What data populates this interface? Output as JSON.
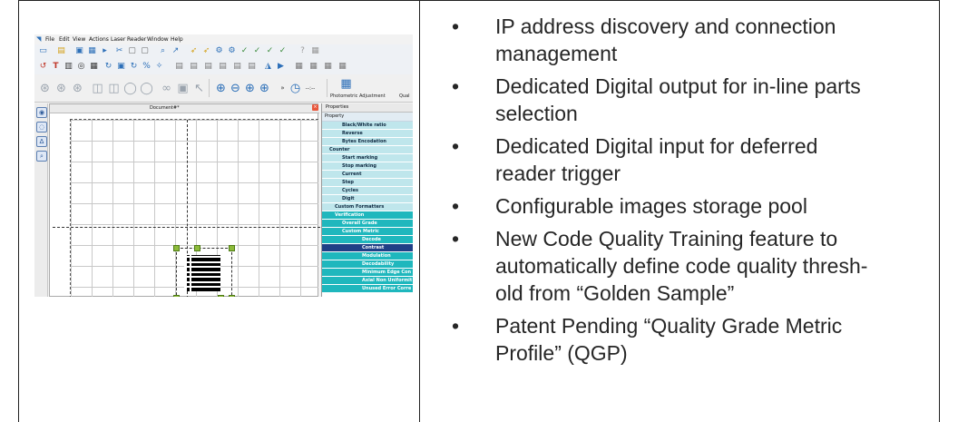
{
  "screenshot": {
    "menu": [
      "File",
      "Edit",
      "View",
      "Actions",
      "Laser",
      "Reader",
      "Window",
      "Help"
    ],
    "toolbar_labels": [
      "Photometric Adjustment",
      "Qual"
    ],
    "document_tab": "Document#*",
    "properties_panel": {
      "title": "Properties",
      "header": "Property",
      "rows": [
        {
          "label": "Black/White ratio",
          "style": "light"
        },
        {
          "label": "Reverse",
          "style": "light"
        },
        {
          "label": "Bytes Encodation",
          "style": "light"
        },
        {
          "label": "Counter",
          "style": "light"
        },
        {
          "label": "Start marking",
          "style": "light"
        },
        {
          "label": "Stop marking",
          "style": "light"
        },
        {
          "label": "Current",
          "style": "light"
        },
        {
          "label": "Step",
          "style": "light"
        },
        {
          "label": "Cycles",
          "style": "light"
        },
        {
          "label": "Digit",
          "style": "light"
        },
        {
          "label": "Custom Formatters",
          "style": "light"
        },
        {
          "label": "Verification",
          "style": "teal"
        },
        {
          "label": "Overall Grade",
          "style": "teal"
        },
        {
          "label": "Custom Metric",
          "style": "teal"
        },
        {
          "label": "Decode",
          "style": "teal"
        },
        {
          "label": "Contrast",
          "style": "selected"
        },
        {
          "label": "Modulation",
          "style": "teal"
        },
        {
          "label": "Decodability",
          "style": "teal"
        },
        {
          "label": "Minimum Edge Con",
          "style": "teal"
        },
        {
          "label": "Axial Non Uniformit",
          "style": "teal"
        },
        {
          "label": "Unused Error Corre",
          "style": "teal"
        }
      ]
    }
  },
  "bullets": [
    [
      "IP address discovery and connection",
      "management"
    ],
    [
      "Dedicated Digital output for in-line parts",
      "selection"
    ],
    [
      "Dedicated Digital input for deferred",
      "reader trigger"
    ],
    [
      "Configurable images storage pool"
    ],
    [
      "New Code Quality Training feature to",
      "automatically define code quality thresh-",
      "old from “Golden Sample”"
    ],
    [
      "Patent Pending “Quality Grade Metric",
      "Profile” (QGP)"
    ]
  ],
  "bullet_char": "•"
}
